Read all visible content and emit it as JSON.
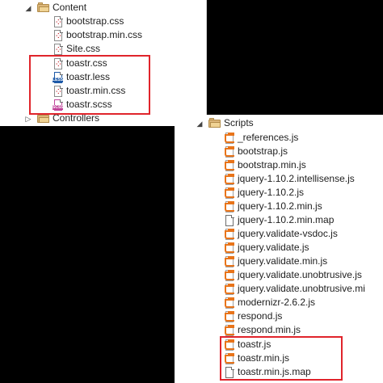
{
  "top_tree": {
    "content_folder": "Content",
    "files": [
      {
        "name": "bootstrap.css",
        "icon": "css-file-icon"
      },
      {
        "name": "bootstrap.min.css",
        "icon": "css-file-icon"
      },
      {
        "name": "Site.css",
        "icon": "css-file-icon"
      },
      {
        "name": "toastr.css",
        "icon": "css-file-icon"
      },
      {
        "name": "toastr.less",
        "icon": "less-file-icon"
      },
      {
        "name": "toastr.min.css",
        "icon": "css-file-icon"
      },
      {
        "name": "toastr.scss",
        "icon": "scss-file-icon"
      }
    ],
    "controllers_folder": "Controllers"
  },
  "bottom_tree": {
    "scripts_folder": "Scripts",
    "files": [
      {
        "name": "_references.js",
        "icon": "js-file-icon"
      },
      {
        "name": "bootstrap.js",
        "icon": "js-file-icon"
      },
      {
        "name": "bootstrap.min.js",
        "icon": "js-file-icon"
      },
      {
        "name": "jquery-1.10.2.intellisense.js",
        "icon": "js-file-icon"
      },
      {
        "name": "jquery-1.10.2.js",
        "icon": "js-file-icon"
      },
      {
        "name": "jquery-1.10.2.min.js",
        "icon": "js-file-icon"
      },
      {
        "name": "jquery-1.10.2.min.map",
        "icon": "map-file-icon"
      },
      {
        "name": "jquery.validate-vsdoc.js",
        "icon": "js-file-icon"
      },
      {
        "name": "jquery.validate.js",
        "icon": "js-file-icon"
      },
      {
        "name": "jquery.validate.min.js",
        "icon": "js-file-icon"
      },
      {
        "name": "jquery.validate.unobtrusive.js",
        "icon": "js-file-icon"
      },
      {
        "name": "jquery.validate.unobtrusive.mi",
        "icon": "js-file-icon"
      },
      {
        "name": "modernizr-2.6.2.js",
        "icon": "js-file-icon"
      },
      {
        "name": "respond.js",
        "icon": "js-file-icon"
      },
      {
        "name": "respond.min.js",
        "icon": "js-file-icon"
      },
      {
        "name": "toastr.js",
        "icon": "js-file-icon"
      },
      {
        "name": "toastr.min.js",
        "icon": "js-file-icon"
      },
      {
        "name": "toastr.min.js.map",
        "icon": "map-file-icon"
      }
    ]
  },
  "colors": {
    "highlight_border": "#e0242b",
    "folder": "#dcb67a",
    "js_accent": "#e8741a",
    "css_accent": "#c5242b",
    "less_accent": "#1e5aa8",
    "scss_accent": "#c0449a"
  }
}
